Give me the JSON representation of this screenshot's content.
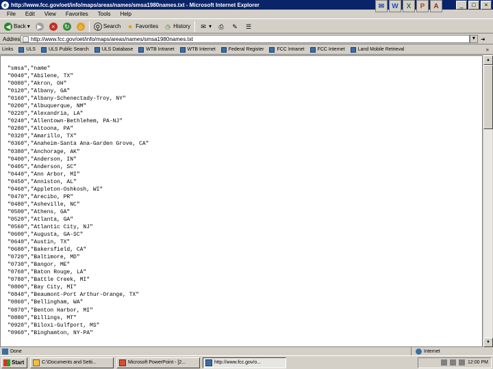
{
  "window": {
    "title": "http://www.fcc.gov/oet/info/maps/areas/names/smsa1980names.txt - Microsoft Internet Explorer",
    "controls": [
      "_",
      "□",
      "×"
    ]
  },
  "menu": [
    "File",
    "Edit",
    "View",
    "Favorites",
    "Tools",
    "Help"
  ],
  "toolbar": {
    "back": "Back",
    "search": "Search",
    "favorites": "Favorites",
    "history": "History"
  },
  "address": {
    "label": "Address",
    "url": "http://www.fcc.gov/oet/info/maps/areas/names/smsa1980names.txt"
  },
  "links": {
    "label": "Links",
    "items": [
      "ULS",
      "ULS Public Search",
      "ULS Database",
      "WTB Intranet",
      "WTB Internet",
      "Federal Register",
      "FCC Intranet",
      "FCC Internet",
      "Land Mobile Retrieval"
    ],
    "more": "»"
  },
  "content": {
    "lines": [
      "\"smsa\",\"name\"",
      "\"0040\",\"Abilene, TX\"",
      "\"0080\",\"Akron, OH\"",
      "\"0120\",\"Albany, GA\"",
      "\"0160\",\"Albany-Schenectady-Troy, NY\"",
      "\"0200\",\"Albuquerque, NM\"",
      "\"0220\",\"Alexandria, LA\"",
      "\"0240\",\"Allentown-Bethlehem, PA-NJ\"",
      "\"0280\",\"Altoona, PA\"",
      "\"0320\",\"Amarillo, TX\"",
      "\"0360\",\"Anaheim-Santa Ana-Garden Grove, CA\"",
      "\"0380\",\"Anchorage, AK\"",
      "\"0400\",\"Anderson, IN\"",
      "\"0405\",\"Anderson, SC\"",
      "\"0440\",\"Ann Arbor, MI\"",
      "\"0450\",\"Anniston, AL\"",
      "\"0460\",\"Appleton-Oshkosh, WI\"",
      "\"0470\",\"Arecibo, PR\"",
      "\"0480\",\"Asheville, NC\"",
      "\"0500\",\"Athens, GA\"",
      "\"0520\",\"Atlanta, GA\"",
      "\"0560\",\"Atlantic City, NJ\"",
      "\"0600\",\"Augusta, GA-SC\"",
      "\"0640\",\"Austin, TX\"",
      "\"0680\",\"Bakersfield, CA\"",
      "\"0720\",\"Baltimore, MD\"",
      "\"0730\",\"Bangor, ME\"",
      "\"0760\",\"Baton Rouge, LA\"",
      "\"0780\",\"Battle Creek, MI\"",
      "\"0800\",\"Bay City, MI\"",
      "\"0840\",\"Beaumont-Port Arthur-Orange, TX\"",
      "\"0860\",\"Bellingham, WA\"",
      "\"0870\",\"Benton Harbor, MI\"",
      "\"0880\",\"Billings, MT\"",
      "\"0920\",\"Biloxi-Gulfport, MS\"",
      "\"0960\",\"Binghamton, NY-PA\""
    ]
  },
  "status": {
    "left": "Done",
    "zone": "Internet"
  },
  "taskbar": {
    "start": "Start",
    "tasks": [
      "C:\\Documents and Setti...",
      "Microsoft PowerPoint - [2...",
      "http://www.fcc.gov/o..."
    ],
    "clock": "12:00 PM"
  }
}
